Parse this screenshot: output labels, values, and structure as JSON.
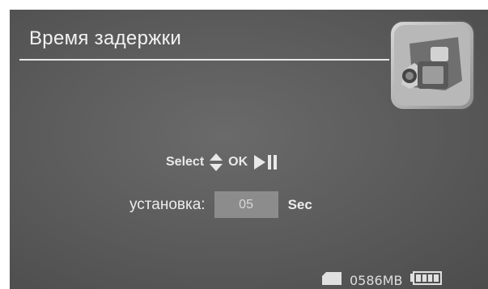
{
  "header": {
    "title": "Время задержки"
  },
  "mode_icon": "camcorder-icon",
  "hint": {
    "select_label": "Select",
    "ok_label": "OK",
    "select_icon": "up-down-arrows-icon",
    "ok_icon": "play-pause-icon"
  },
  "setting": {
    "label": "установка:",
    "value": "05",
    "unit": "Sec"
  },
  "status": {
    "storage_icon": "memory-card-icon",
    "free_space": "0586MB",
    "battery_icon": "battery-icon",
    "battery_level": 1.0
  },
  "colors": {
    "background": "#5a5a5a",
    "text": "#f2f2f2",
    "value_box": "#8c8c8c"
  }
}
